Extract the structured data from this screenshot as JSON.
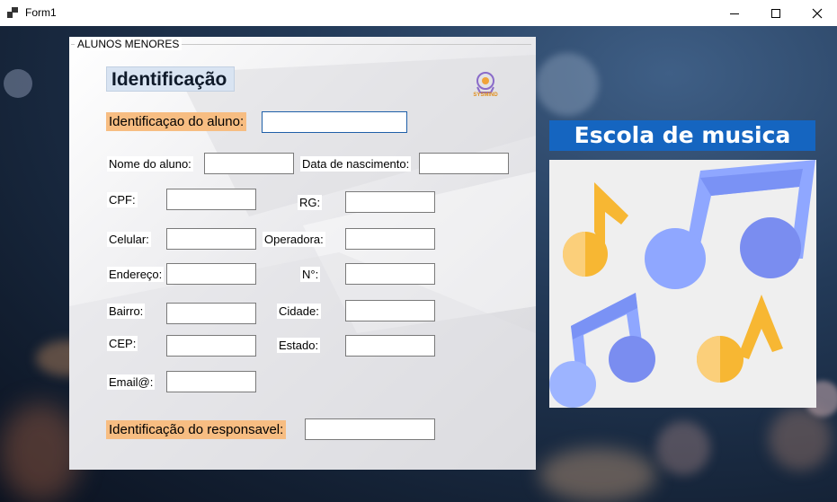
{
  "window": {
    "title": "Form1",
    "icon": "app-form-icon",
    "controls": [
      "minimize-icon",
      "maximize-icon",
      "close-icon"
    ]
  },
  "group": {
    "legend": "ALUNOS MENORES",
    "heading": "Identificação",
    "logo_text": "SYSMIND"
  },
  "fields": {
    "student_id": {
      "label": "Identificaçao do aluno:",
      "value": ""
    },
    "name": {
      "label": "Nome do aluno:",
      "value": ""
    },
    "birth_date": {
      "label": "Data de nascimento:",
      "value": ""
    },
    "cpf": {
      "label": "CPF:",
      "value": ""
    },
    "rg": {
      "label": "RG:",
      "value": ""
    },
    "phone": {
      "label": "Celular:",
      "value": ""
    },
    "carrier": {
      "label": "Operadora:",
      "value": ""
    },
    "address": {
      "label": "Endereço:",
      "value": ""
    },
    "number": {
      "label": "N°:",
      "value": ""
    },
    "district": {
      "label": "Bairro:",
      "value": ""
    },
    "city": {
      "label": "Cidade:",
      "value": ""
    },
    "zip": {
      "label": "CEP:",
      "value": ""
    },
    "state": {
      "label": "Estado:",
      "value": ""
    },
    "email": {
      "label": "Email@:",
      "value": ""
    },
    "guardian_id": {
      "label": "Identificação do responsavel:",
      "value": ""
    }
  },
  "side": {
    "banner": "Escola de musica",
    "image": "music-notes-icon"
  },
  "colors": {
    "label_highlight": "#f7bd82",
    "banner_bg": "#1565c0",
    "note_orange": "#f7b733",
    "note_blue": "#8fa7ff"
  }
}
